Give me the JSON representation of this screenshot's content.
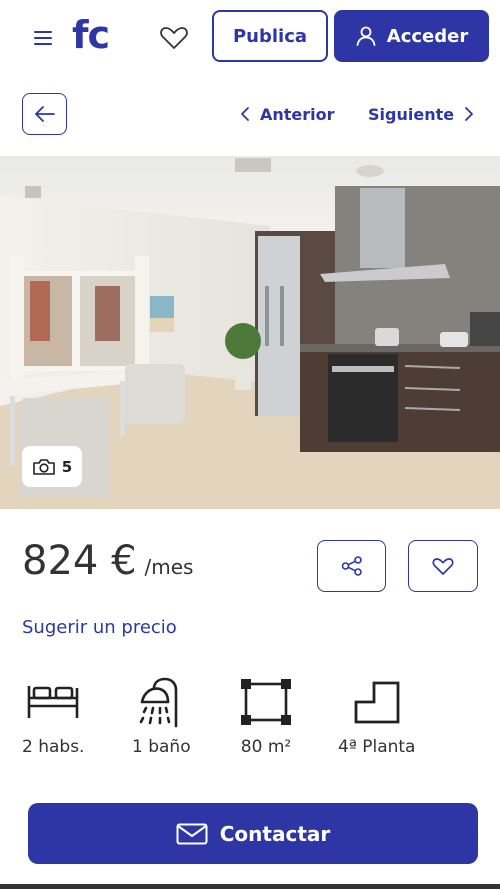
{
  "header": {
    "logo": "fc",
    "publish_label": "Publica",
    "login_label": "Acceder",
    "icons": [
      "menu-icon",
      "heart-icon",
      "user-icon"
    ]
  },
  "nav": {
    "prev_label": "Anterior",
    "next_label": "Siguiente"
  },
  "gallery": {
    "photo_count": "5"
  },
  "listing": {
    "price": "824 €",
    "price_unit": "/mes",
    "suggest_price": "Sugerir un precio"
  },
  "features": {
    "rooms": "2 habs.",
    "baths": "1 baño",
    "area": "80 m²",
    "floor": "4ª Planta"
  },
  "cta": {
    "contact_label": "Contactar"
  },
  "colors": {
    "brand": "#2e36a6",
    "text": "#333333"
  }
}
